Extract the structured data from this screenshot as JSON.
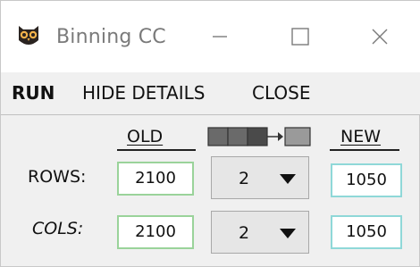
{
  "window": {
    "title": "Binning CC",
    "icon": "owl-icon",
    "controls": [
      "minimize-icon",
      "maximize-icon",
      "close-icon"
    ]
  },
  "menu": {
    "run": "RUN",
    "hide_details": "HIDE DETAILS",
    "close": "CLOSE"
  },
  "table": {
    "old_header": "OLD",
    "new_header": "NEW",
    "binning_icon": "pixel-binning-icon",
    "rows": {
      "label": "ROWS:",
      "old": "2100",
      "factor": "2",
      "new": "1050"
    },
    "cols": {
      "label": "COLS:",
      "old": "2100",
      "factor": "2",
      "new": "1050"
    }
  },
  "colors": {
    "old_input_border": "#9ad39a",
    "new_input_border": "#8fd8d8",
    "window_bg": "#f0f0f0"
  }
}
